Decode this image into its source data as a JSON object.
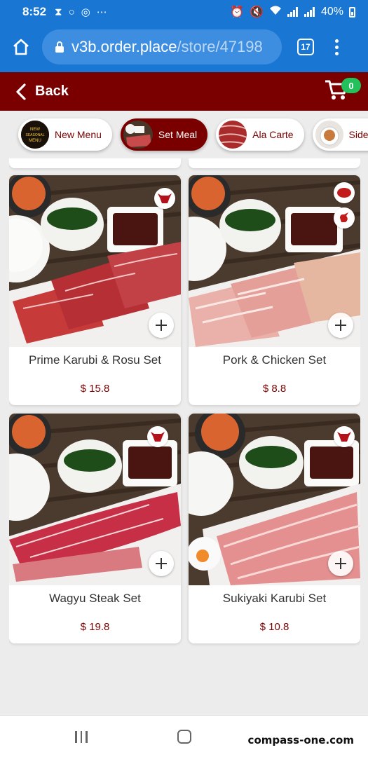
{
  "status_bar": {
    "time": "8:52",
    "battery": "40%"
  },
  "browser": {
    "url_domain": "v3b.order.place",
    "url_path": "/store/47198",
    "tab_count": "17"
  },
  "header": {
    "back_label": "Back",
    "cart_count": "0"
  },
  "categories": [
    {
      "label": "New Menu",
      "thumb_text": "New Seasonal Menu",
      "active": false
    },
    {
      "label": "Set Meal",
      "active": true
    },
    {
      "label": "Ala Carte",
      "active": false
    },
    {
      "label": "Side Dish",
      "active": false
    }
  ],
  "products": [
    {
      "name": "Prime Karubi & Rosu Set",
      "price": "$ 15.8",
      "tags": [
        "beef-icon"
      ]
    },
    {
      "name": "Pork & Chicken Set",
      "price": "$ 8.8",
      "tags": [
        "pork-icon",
        "chicken-icon"
      ]
    },
    {
      "name": "Wagyu Steak Set",
      "price": "$ 19.8",
      "tags": [
        "beef-icon"
      ]
    },
    {
      "name": "Sukiyaki Karubi Set",
      "price": "$ 10.8",
      "tags": [
        "beef-icon"
      ]
    }
  ],
  "watermark": "compass-one.com",
  "colors": {
    "browser_bar": "#1976d2",
    "brand": "#7a0000",
    "badge": "#22c15b"
  }
}
